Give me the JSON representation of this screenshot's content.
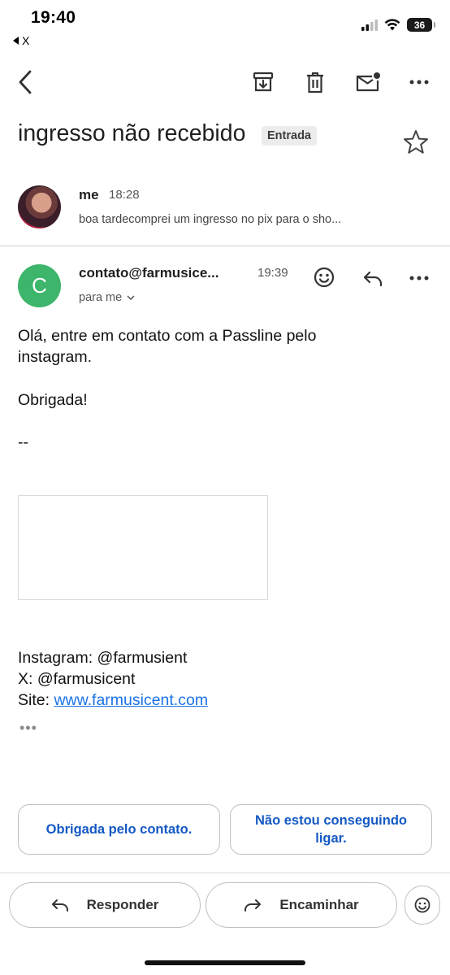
{
  "status_bar": {
    "time": "19:40",
    "back_app": "X",
    "battery": "36"
  },
  "toolbar": {
    "icons": [
      "back-arrow-icon",
      "archive-icon",
      "delete-icon",
      "mark-unread-icon",
      "more-icon"
    ]
  },
  "email": {
    "subject": "ingresso não recebido",
    "label": "Entrada"
  },
  "thread": {
    "message1": {
      "sender": "me",
      "time": "18:28",
      "snippet": "boa tardecomprei um ingresso no pix para o sho..."
    },
    "message2": {
      "avatar_letter": "C",
      "sender": "contato@farmusice...",
      "time": "19:39",
      "recipient": "para me",
      "body": {
        "line1": "Olá, entre em contato com a Passline pelo",
        "line2": "instagram.",
        "line3": "Obrigada!",
        "line4": "--"
      },
      "signature": {
        "instagram": "Instagram: @farmusient",
        "x": "X: @farmusicent",
        "site_prefix": "Site: ",
        "site_link": "www.farmusicent.com"
      },
      "trimmed": "•••"
    }
  },
  "smart_replies": {
    "reply1": "Obrigada pelo contato.",
    "reply2_line1": "Não estou conseguindo",
    "reply2_line2": "ligar."
  },
  "actions": {
    "reply": "Responder",
    "forward": "Encaminhar"
  },
  "colors": {
    "accent_blue": "#1a73e8",
    "smart_reply_blue": "#1459c4",
    "avatar_green": "#3db56b"
  }
}
